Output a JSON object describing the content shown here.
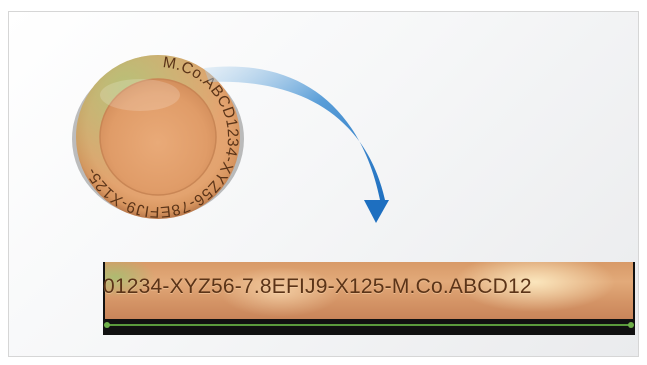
{
  "coin": {
    "engraved_text": "M.Co.ABCD1234-XYZ56-78EFIJ9-X125-"
  },
  "strip": {
    "text": "01234-XYZ56-7.8EFIJ9-X125-M.Co.ABCD12"
  },
  "colors": {
    "copper": "#d99c6a",
    "engraving": "#5b3418",
    "arrow": "#2a7fcf",
    "rule": "#5a9a3c"
  },
  "icons": {
    "arrow": "curved-arrow-icon"
  }
}
